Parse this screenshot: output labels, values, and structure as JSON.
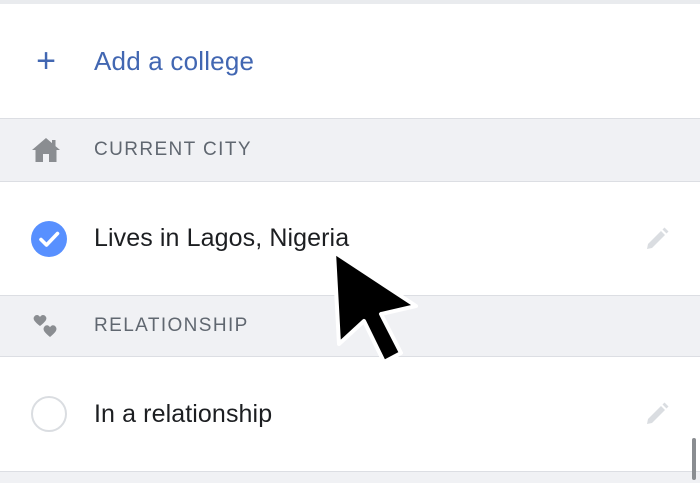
{
  "education": {
    "add_college_label": "Add a college"
  },
  "sections": {
    "current_city": {
      "header": "CURRENT CITY",
      "item_label": "Lives in Lagos, Nigeria",
      "selected": true
    },
    "relationship": {
      "header": "RELATIONSHIP",
      "item_label": "In a relationship",
      "selected": false
    }
  },
  "icons": {
    "add": "plus-icon",
    "city": "home-icon",
    "relationship": "hearts-icon",
    "selected": "check-circle-icon",
    "unselected": "empty-circle-icon",
    "edit": "pencil-icon"
  },
  "colors": {
    "link_blue": "#4267b2",
    "check_blue": "#5890ff",
    "section_bg": "#f0f1f4",
    "muted_text": "#606770",
    "icon_gray": "#8a8d91",
    "pencil_gray": "#dadde1"
  }
}
